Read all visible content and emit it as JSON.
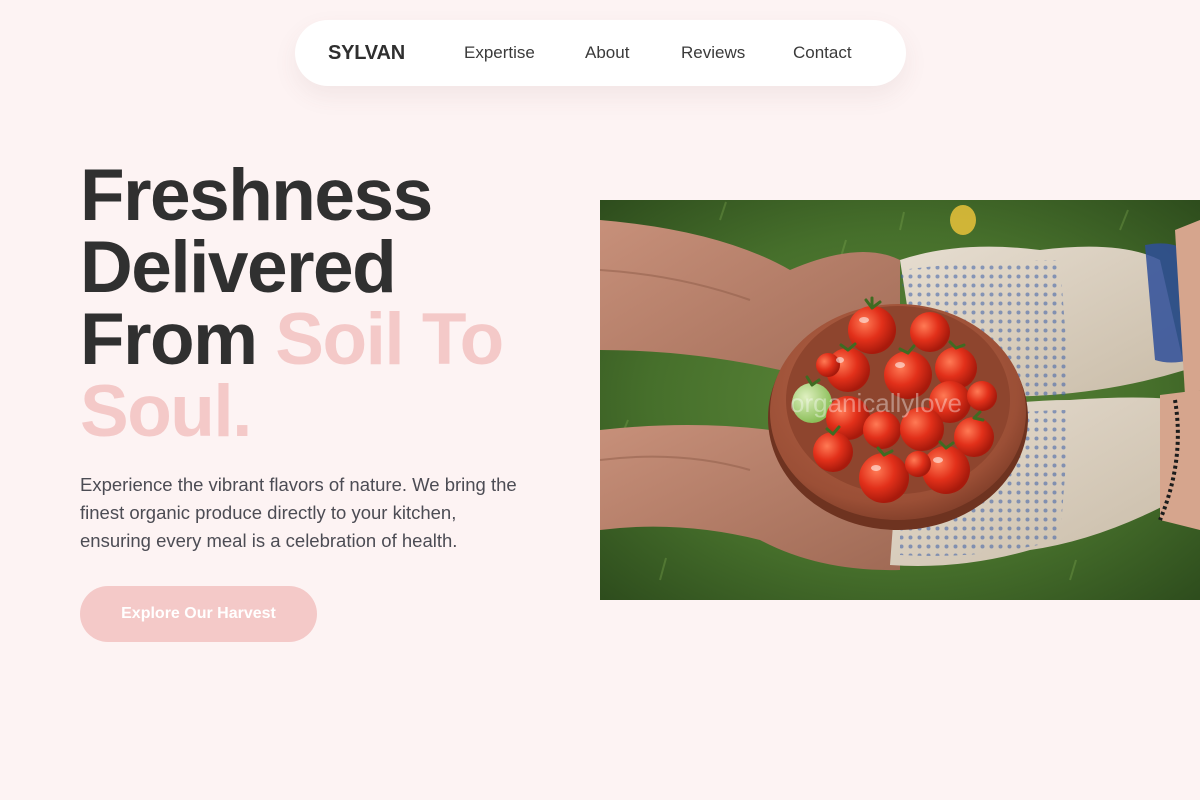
{
  "colors": {
    "background": "#fdf3f3",
    "accent": "#f4c9c8",
    "heading": "#303030",
    "body_text": "#4c4c54"
  },
  "nav": {
    "brand": "SYLVAN",
    "links": [
      {
        "label": "Expertise"
      },
      {
        "label": "About"
      },
      {
        "label": "Reviews"
      },
      {
        "label": "Contact"
      }
    ]
  },
  "hero": {
    "headline_line1": "Freshness",
    "headline_line2": "Delivered",
    "headline_line3_dark": "From ",
    "headline_line3_accent": "Soil To",
    "headline_line4_accent": "Soul.",
    "description": "Experience the vibrant flavors of nature. We bring the finest organic produce directly to your kitchen, ensuring every meal is a celebration of health.",
    "cta_label": "Explore Our Harvest",
    "image_watermark": "organicallylove"
  }
}
